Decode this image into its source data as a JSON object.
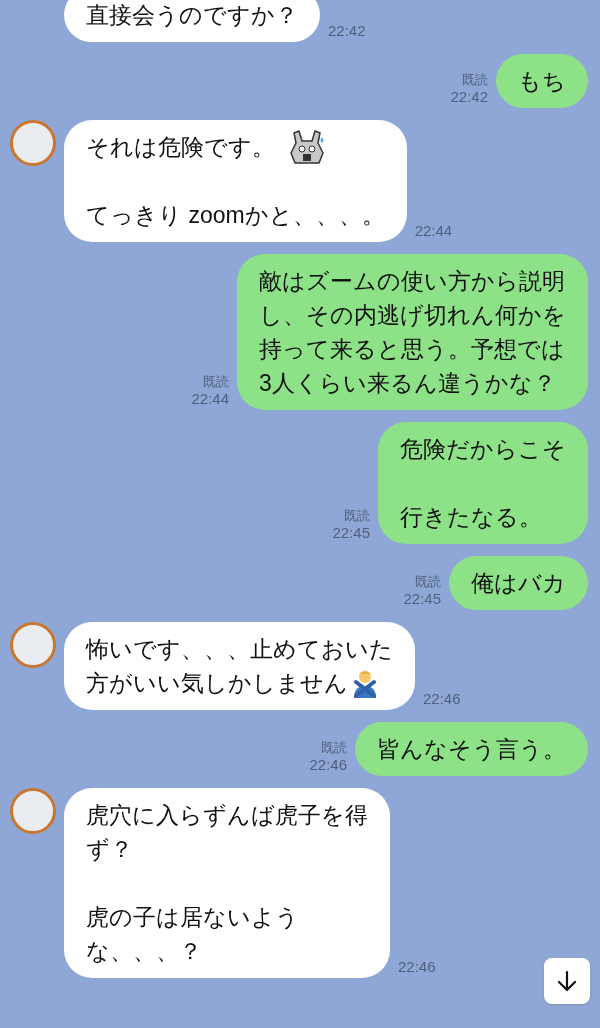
{
  "messages": [
    {
      "kind": "incoming",
      "avatar": false,
      "lines": [
        {
          "kind": "text",
          "text": "直接会うのですか？"
        }
      ],
      "time": "22:42"
    },
    {
      "kind": "outgoing",
      "read_label": "既読",
      "lines": [
        {
          "kind": "text",
          "text": "もち"
        }
      ],
      "time": "22:42"
    },
    {
      "kind": "incoming",
      "avatar": true,
      "lines": [
        {
          "kind": "text_emoji",
          "text": "それは危険です。"
        },
        {
          "kind": "blank"
        },
        {
          "kind": "text",
          "text": "てっきり zoomかと、、、。"
        }
      ],
      "time": "22:44"
    },
    {
      "kind": "outgoing",
      "read_label": "既読",
      "lines": [
        {
          "kind": "text",
          "text": "敵はズームの使い方から説明"
        },
        {
          "kind": "text",
          "text": "し、その内逃げ切れん何かを"
        },
        {
          "kind": "text",
          "text": "持って来ると思う。予想では"
        },
        {
          "kind": "text",
          "text": "3人くらい来るん違うかな？"
        }
      ],
      "time": "22:44"
    },
    {
      "kind": "outgoing",
      "read_label": "既読",
      "lines": [
        {
          "kind": "text",
          "text": "危険だからこそ"
        },
        {
          "kind": "blank"
        },
        {
          "kind": "text",
          "text": "行きたなる。"
        }
      ],
      "time": "22:45"
    },
    {
      "kind": "outgoing",
      "read_label": "既読",
      "lines": [
        {
          "kind": "text",
          "text": "俺はバカ"
        }
      ],
      "time": "22:45"
    },
    {
      "kind": "incoming",
      "avatar": true,
      "lines": [
        {
          "kind": "text",
          "text": "怖いです、、、止めておいた"
        },
        {
          "kind": "text_emoji",
          "text": "方がいい気しかしません"
        }
      ],
      "time": "22:46"
    },
    {
      "kind": "outgoing",
      "read_label": "既読",
      "lines": [
        {
          "kind": "text",
          "text": "皆んなそう言う。"
        }
      ],
      "time": "22:46"
    },
    {
      "kind": "incoming",
      "avatar": true,
      "lines": [
        {
          "kind": "text",
          "text": "虎穴に入らずんば虎子を得"
        },
        {
          "kind": "text",
          "text": "ず？"
        },
        {
          "kind": "blank"
        },
        {
          "kind": "text",
          "text": "虎の子は居ないよう"
        },
        {
          "kind": "text",
          "text": "な、、、？"
        }
      ],
      "time": "22:46"
    }
  ]
}
